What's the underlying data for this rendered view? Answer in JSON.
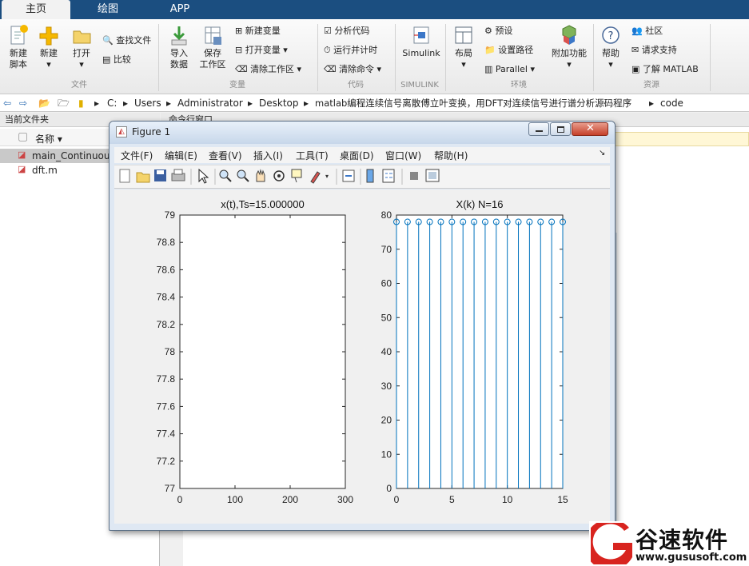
{
  "tabs": [
    {
      "label": "主页"
    },
    {
      "label": "绘图"
    },
    {
      "label": "APP"
    }
  ],
  "ribbon": {
    "file": {
      "new_script": [
        "新建",
        "脚本"
      ],
      "new": "新建",
      "open": "打开",
      "find_files": "查找文件",
      "compare": "比较",
      "group": "文件"
    },
    "variable": {
      "import": [
        "导入",
        "数据"
      ],
      "save": [
        "保存",
        "工作区"
      ],
      "new_var": "新建变量",
      "open_var": "打开变量",
      "clear_ws": "清除工作区",
      "group": "变量"
    },
    "code": {
      "analyze": "分析代码",
      "run_time": "运行并计时",
      "clear_cmd": "清除命令",
      "group": "代码"
    },
    "simulink": {
      "label": "Simulink",
      "group": "SIMULINK"
    },
    "env": {
      "layout": "布局",
      "prefs": "预设",
      "set_path": "设置路径",
      "parallel": "Parallel",
      "addons": "附加功能",
      "group": "环境"
    },
    "resources": {
      "help": "帮助",
      "community": "社区",
      "support": "请求支持",
      "learn": "了解 MATLAB",
      "group": "资源"
    }
  },
  "address": [
    "C:",
    "Users",
    "Administrator",
    "Desktop",
    "matlab编程连续信号离散傅立叶变换，用DFT对连续信号进行谱分析源码程序",
    "code"
  ],
  "leftpane": {
    "title": "当前文件夹",
    "col_name": "名称 ▾",
    "files": [
      "main_Continuous",
      "dft.m"
    ]
  },
  "rightpane": {
    "title": "命令行窗口"
  },
  "figure": {
    "title": "Figure 1",
    "menus": [
      "文件(F)",
      "编辑(E)",
      "查看(V)",
      "插入(I)",
      "工具(T)",
      "桌面(D)",
      "窗口(W)",
      "帮助(H)"
    ]
  },
  "chart_data": [
    {
      "type": "line",
      "title": "x(t),Ts=15.000000",
      "xlim": [
        0,
        300
      ],
      "ylim": [
        77,
        79
      ],
      "xticks": [
        "0",
        "100",
        "200",
        "300"
      ],
      "yticks": [
        "77",
        "77.2",
        "77.4",
        "77.6",
        "77.8",
        "78",
        "78.2",
        "78.4",
        "78.6",
        "78.8",
        "79"
      ],
      "x": [],
      "y": []
    },
    {
      "type": "stem",
      "title": "X(k) N=16",
      "xlim": [
        0,
        15
      ],
      "ylim": [
        0,
        80
      ],
      "xticks": [
        "0",
        "5",
        "10",
        "15"
      ],
      "yticks": [
        "0",
        "10",
        "20",
        "30",
        "40",
        "50",
        "60",
        "70",
        "80"
      ],
      "x": [
        0,
        1,
        2,
        3,
        4,
        5,
        6,
        7,
        8,
        9,
        10,
        11,
        12,
        13,
        14,
        15
      ],
      "y": [
        78,
        78,
        78,
        78,
        78,
        78,
        78,
        78,
        78,
        78,
        78,
        78,
        78,
        78,
        78,
        78
      ],
      "color": "#0072bd"
    }
  ],
  "watermark": {
    "brand": "谷速软件",
    "url": "www.gususoft.com"
  }
}
